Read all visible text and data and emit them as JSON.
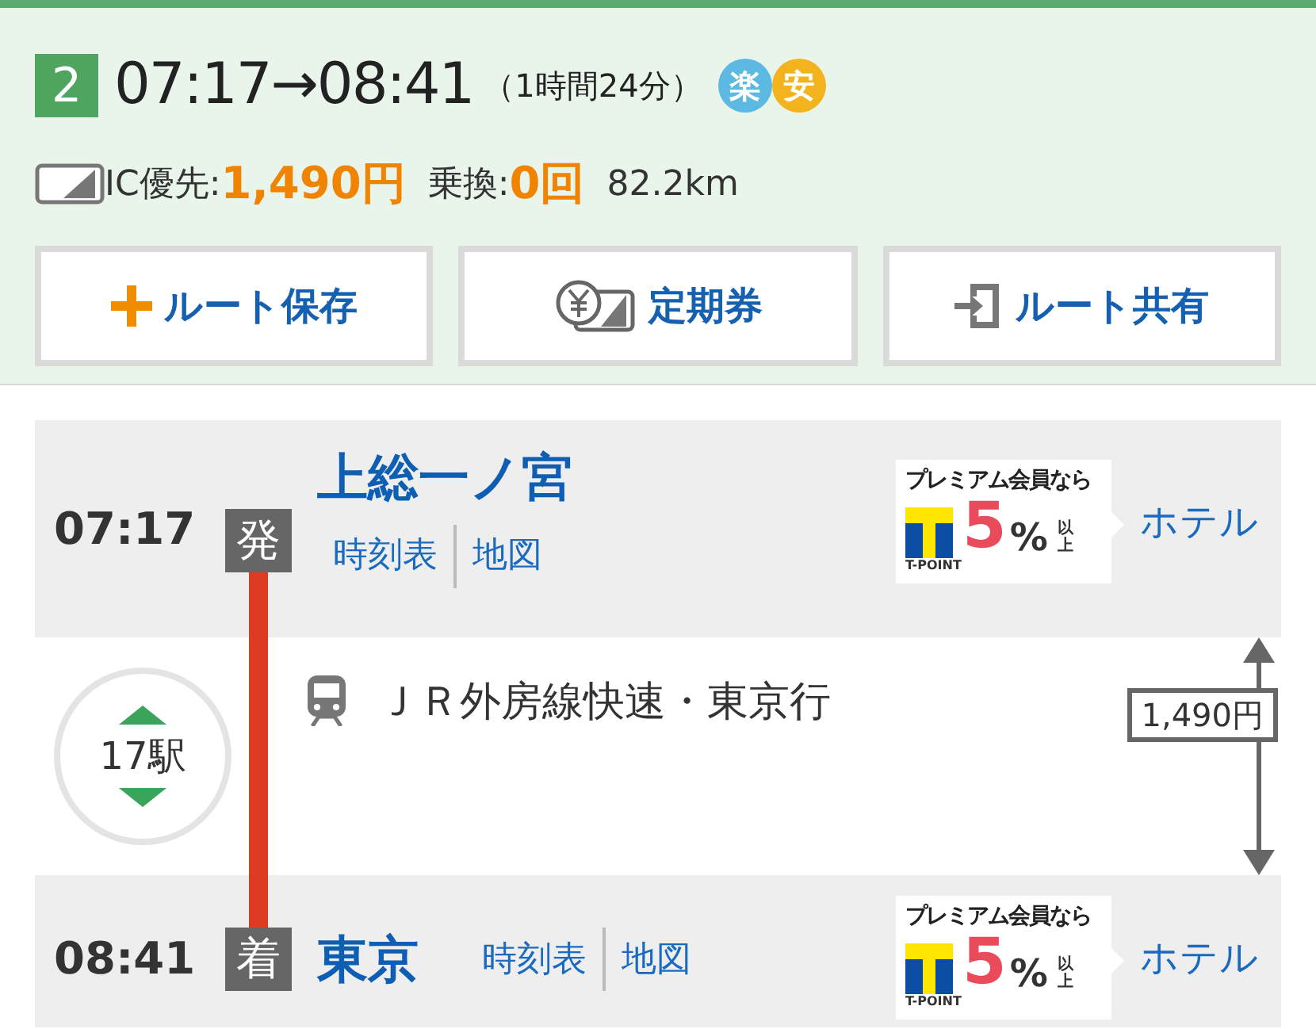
{
  "route": {
    "number": "2",
    "time_range": "07:17→08:41",
    "duration": "（1時間24分）",
    "badges": [
      {
        "text": "楽",
        "color": "#5cb9e2"
      },
      {
        "text": "安",
        "color": "#f3b31d"
      }
    ]
  },
  "summary": {
    "fare_label": "IC優先:",
    "fare": "1,490円",
    "transfer_label": "乗換:",
    "transfers": "0回",
    "distance": "82.2km"
  },
  "actions": [
    {
      "kind": "save",
      "label": "ルート保存"
    },
    {
      "kind": "pass",
      "label": "定期券"
    },
    {
      "kind": "share",
      "label": "ルート共有"
    }
  ],
  "stops": [
    {
      "kind": "departure",
      "time": "07:17",
      "badge": "発",
      "name": "上総一ノ宮",
      "links": [
        "時刻表",
        "地図"
      ],
      "ad": {
        "headline": "プレミアム会員なら",
        "rate": "5",
        "unit": "%",
        "suffix": "以上",
        "brand": "T-POINT"
      },
      "hotel": "ホテル"
    },
    {
      "kind": "arrival",
      "time": "08:41",
      "badge": "着",
      "name": "東京",
      "links": [
        "時刻表",
        "地図"
      ],
      "ad": {
        "headline": "プレミアム会員なら",
        "rate": "5",
        "unit": "%",
        "suffix": "以上",
        "brand": "T-POINT"
      },
      "hotel": "ホテル"
    }
  ],
  "segment": {
    "stations": "17駅",
    "line": "ＪＲ外房線快速・東京行",
    "fare": "1,490円"
  }
}
